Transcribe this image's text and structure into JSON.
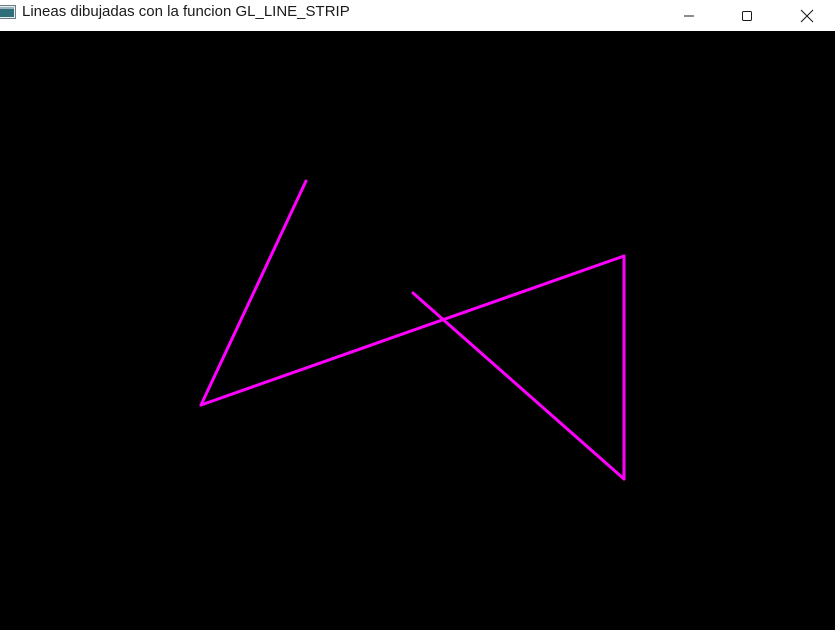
{
  "window": {
    "title": "Lineas dibujadas con la funcion GL_LINE_STRIP",
    "controls": {
      "minimize_icon": "minimize-icon",
      "maximize_icon": "maximize-icon",
      "close_icon": "close-icon"
    }
  },
  "canvas": {
    "background_color": "#000000",
    "line_color": "#ff00ff",
    "primitive": "line-strip"
  }
}
